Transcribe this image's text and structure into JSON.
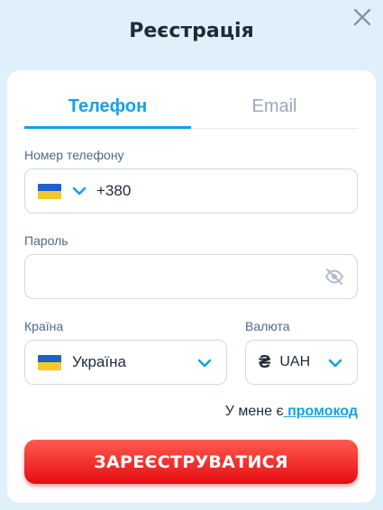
{
  "dialog": {
    "title": "Реєстрація"
  },
  "tabs": [
    {
      "label": "Телефон",
      "active": true
    },
    {
      "label": "Email",
      "active": false
    }
  ],
  "phone": {
    "label": "Номер телефону",
    "country_code": "+380",
    "flag": "ukraine-flag"
  },
  "password": {
    "label": "Пароль",
    "value": "",
    "visibility_icon": "eye-off-icon"
  },
  "country": {
    "label": "Країна",
    "value": "Україна",
    "flag": "ukraine-flag"
  },
  "currency": {
    "label": "Валюта",
    "symbol": "₴",
    "value": "UAH"
  },
  "promo": {
    "prefix": "У мене є",
    "link": " промокод"
  },
  "register_button": {
    "label": "ЗАРЕЄСТРУВАТИСЯ"
  },
  "colors": {
    "accent": "#14a1e5",
    "button_red": "#e60d12",
    "background": "#dff0fb"
  }
}
